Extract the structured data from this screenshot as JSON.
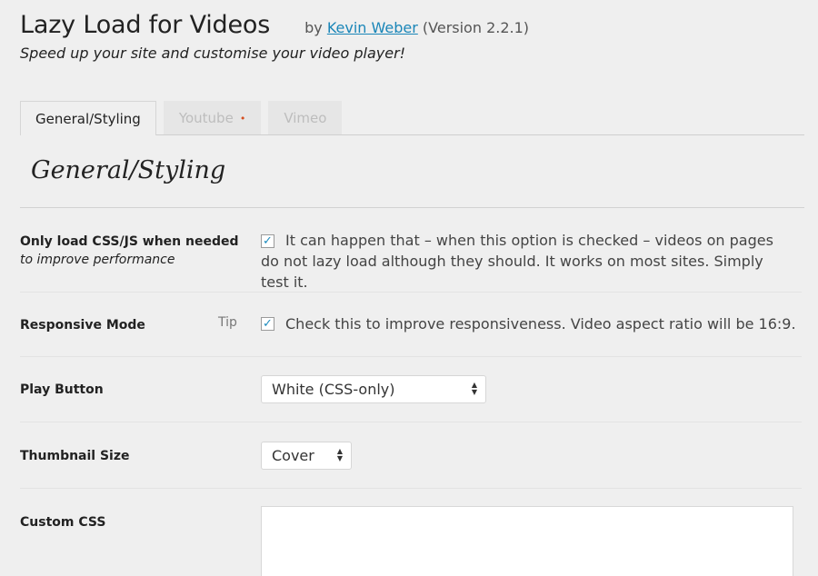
{
  "header": {
    "title": "Lazy Load for Videos",
    "by_prefix": "by",
    "author": "Kevin Weber",
    "version": "(Version 2.2.1)",
    "tagline": "Speed up your site and customise your video player!"
  },
  "tabs": [
    {
      "label": "General/Styling",
      "active": true
    },
    {
      "label": "Youtube",
      "active": false,
      "dot": "•"
    },
    {
      "label": "Vimeo",
      "active": false
    }
  ],
  "section": {
    "title": "General/Styling"
  },
  "options": {
    "css_js": {
      "label": "Only load CSS/JS when needed",
      "sublabel": "to improve performance",
      "checked": true,
      "check_glyph": "✓",
      "text": "It can happen that – when this option is checked – videos on pages do not lazy load although they should. It works on most sites. Simply test it."
    },
    "responsive": {
      "label": "Responsive Mode",
      "tip": "Tip",
      "checked": true,
      "check_glyph": "✓",
      "text": "Check this to improve responsiveness. Video aspect ratio will be 16:9."
    },
    "play_button": {
      "label": "Play Button",
      "selected": "White (CSS-only)"
    },
    "thumbnail": {
      "label": "Thumbnail Size",
      "selected": "Cover"
    },
    "custom_css": {
      "label": "Custom CSS",
      "value": ""
    }
  },
  "icons": {
    "select_arrow_up": "▲",
    "select_arrow_down": "▼"
  },
  "colors": {
    "background": "#efefef",
    "link": "#1a86b8",
    "checkmark": "#1e8cbe",
    "tab_dot": "#d54e21"
  }
}
